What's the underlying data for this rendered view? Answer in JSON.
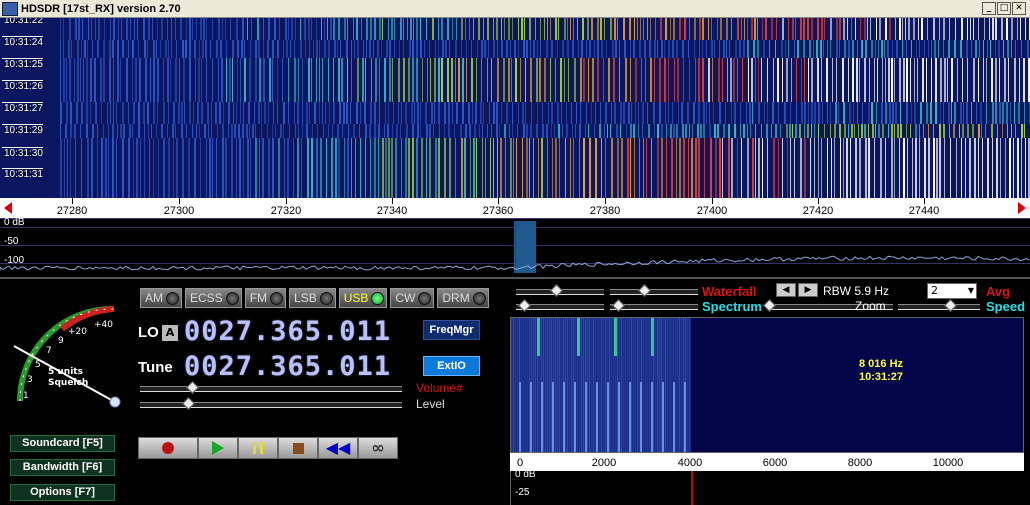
{
  "window": {
    "title": "HDSDR [17st_RX]  version 2.70",
    "controls": [
      "_",
      "□",
      "✕"
    ]
  },
  "waterfall": {
    "times": [
      "10:31:22",
      "10:31:24",
      "10:31:25",
      "10:31:26",
      "10:31:27",
      "10:31:29",
      "10:31:30",
      "10:31:31"
    ]
  },
  "rf_scale": {
    "labels": [
      "27280",
      "27300",
      "27320",
      "27340",
      "27360",
      "27380",
      "27400",
      "27420",
      "27440"
    ]
  },
  "rf_spectrum": {
    "db_labels": [
      "0 dB",
      "-50",
      "-100"
    ]
  },
  "smeter": {
    "labels": [
      "1",
      "3",
      "5",
      "7",
      "9",
      "+20",
      "+40"
    ],
    "squelch_line1": "5 units",
    "squelch_line2": "Squelch"
  },
  "side_buttons": {
    "soundcard": "Soundcard   [F5]",
    "bandwidth": "Bandwidth   [F6]",
    "options": "Options    [F7]"
  },
  "modes": [
    {
      "label": "AM",
      "active": false
    },
    {
      "label": "ECSS",
      "active": false
    },
    {
      "label": "FM",
      "active": false
    },
    {
      "label": "LSB",
      "active": false
    },
    {
      "label": "USB",
      "active": true
    },
    {
      "label": "CW",
      "active": false
    },
    {
      "label": "DRM",
      "active": false
    }
  ],
  "lo": {
    "label": "LO",
    "badge": "A",
    "value": "0027.365.011"
  },
  "tune": {
    "label": "Tune",
    "value": "0027.365.011"
  },
  "buttons": {
    "freqmgr": "FreqMgr",
    "extio": "ExtIO"
  },
  "sliders": {
    "volume_label": "Volume#",
    "level_label": "Level"
  },
  "transport": [
    "record-icon",
    "play-icon",
    "pause-icon",
    "stop-icon",
    "rewind-icon",
    "loop-icon"
  ],
  "display_controls": {
    "waterfall_label": "Waterfall",
    "spectrum_label": "Spectrum",
    "rbw_label": "RBW  5.9 Hz",
    "zoom_label": "Zoom",
    "avg_label": "Avg",
    "speed_label": "Speed",
    "avg_value": "2"
  },
  "af_display": {
    "freq": "8 016 Hz",
    "time": "10:31:27",
    "scale_labels": [
      "0",
      "2000",
      "4000",
      "6000",
      "8000",
      "10000"
    ],
    "db_labels": [
      "0 dB",
      "-25"
    ]
  },
  "colors": {
    "waterfall_bg": "#0a1760",
    "active_mode": "#ffff33",
    "freq_digits": "#b8c0ff",
    "waterfall_label": "#e01010",
    "spectrum_label": "#21e0ea"
  }
}
